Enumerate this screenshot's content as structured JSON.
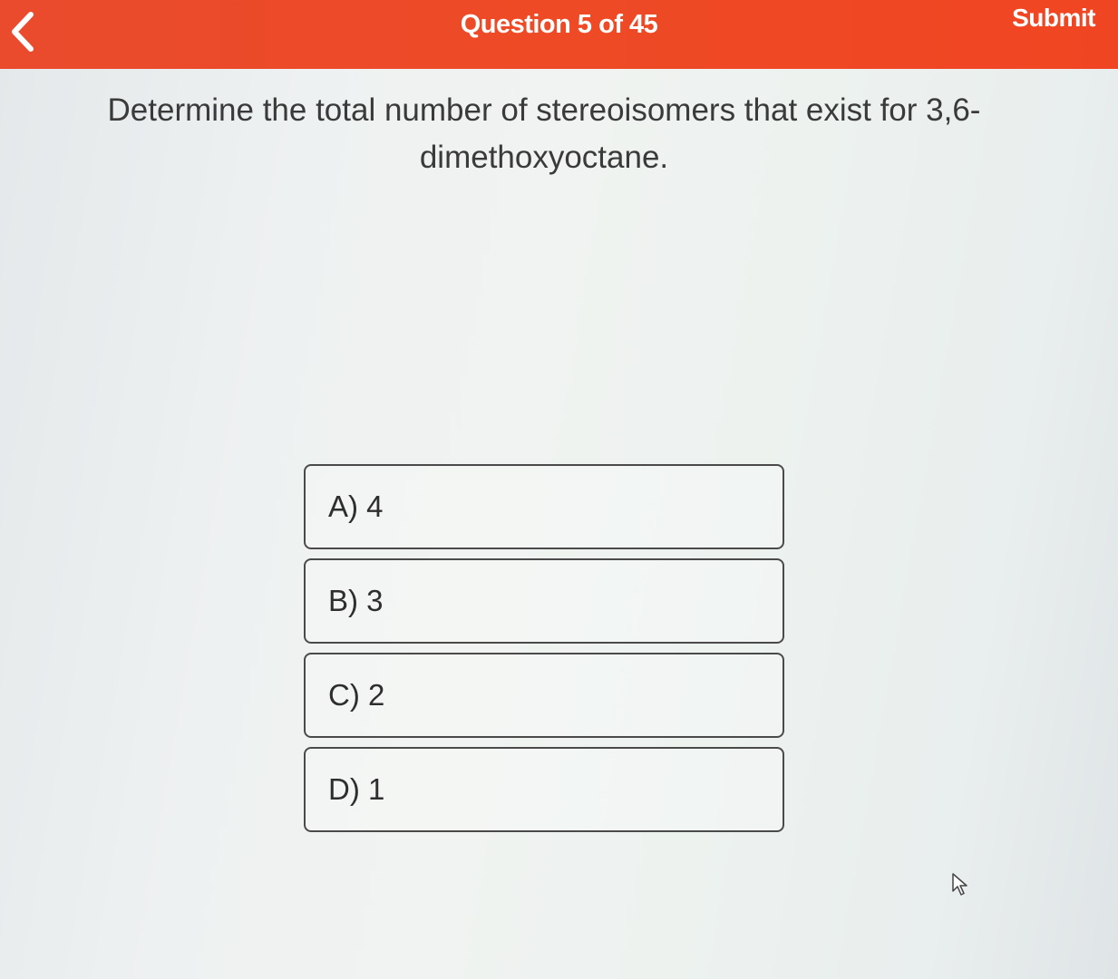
{
  "header": {
    "title": "Question 5 of 45",
    "submit_label": "Submit",
    "back_icon": "chevron-left-icon",
    "background_color": "#ee4a26"
  },
  "question": {
    "text": "Determine the total number of stereoisomers that exist for 3,6-dimethoxyoctane."
  },
  "options": [
    {
      "label": "A) 4"
    },
    {
      "label": "B) 3"
    },
    {
      "label": "C) 2"
    },
    {
      "label": "D) 1"
    }
  ],
  "cursor": {
    "icon": "mouse-pointer-icon"
  }
}
